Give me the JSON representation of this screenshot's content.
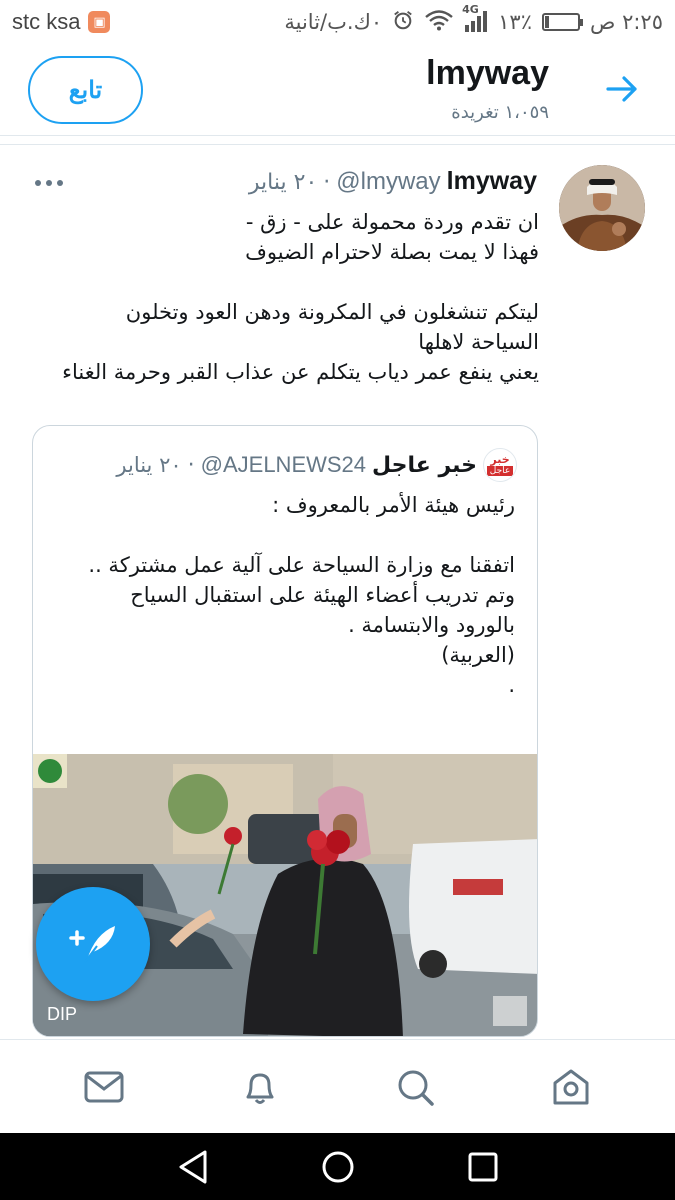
{
  "status_bar": {
    "carrier": "stc ksa",
    "time": "٢:٢٥ ص",
    "battery": "١٣٪",
    "network": "4G",
    "speed": "٠ك.ب/ثانية"
  },
  "header": {
    "follow_label": "تابع",
    "title": "lmyway",
    "tweet_count": "١،٠٥٩ تغريدة"
  },
  "tweet": {
    "author_name": "lmyway",
    "handle": "@lmyway",
    "separator": "·",
    "date": "٢٠ يناير",
    "lines": [
      "ان تقدم وردة  محمولة على - زق -",
      "فهذا لا يمت  بصلة لاحترام الضيوف",
      "",
      " ليتكم تنشغلون في المكرونة ودهن العود وتخلون",
      "السياحة لاهلها",
      "يعني ينفع عمر دياب يتكلم عن عذاب القبر وحرمة الغناء"
    ]
  },
  "quoted_tweet": {
    "logo_top": "خبر",
    "logo_bottom": "عاجل",
    "author_name": "خبر عاجل",
    "handle": "@AJELNEWS24",
    "separator": "·",
    "date": "٢٠ يناير",
    "lines": [
      "رئيس هيئة الأمر بالمعروف :",
      "",
      "اتفقنا مع وزارة السياحة على آلية عمل مشتركة ..",
      "وتم تدريب أعضاء الهيئة على استقبال السياح",
      "بالورود والابتسامة .",
      "(العربية)",
      "."
    ]
  },
  "colors": {
    "accent": "#1da1f2",
    "text_primary": "#14171a",
    "text_secondary": "#657786",
    "border": "#e1e8ed"
  },
  "icons": {
    "back": "arrow-right-icon",
    "more": "more-horizontal-icon",
    "compose": "compose-feather-icon",
    "nav": [
      "mail-icon",
      "bell-icon",
      "search-icon",
      "home-icon"
    ],
    "system": [
      "back-triangle-icon",
      "home-circle-icon",
      "recents-square-icon"
    ]
  }
}
